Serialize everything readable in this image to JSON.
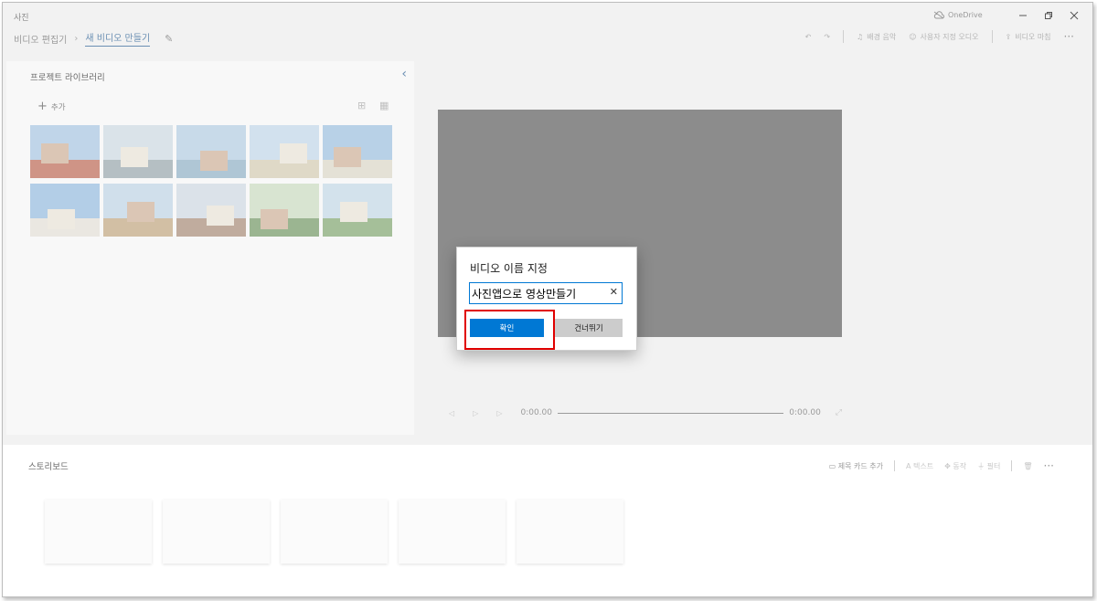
{
  "app": {
    "title": "사진",
    "onedrive_label": "OneDrive"
  },
  "breadcrumb": {
    "items": [
      "비디오 편집기",
      "새 비디오 만들기"
    ]
  },
  "toolbar": {
    "background_music": "배경 음악",
    "custom_audio": "사용자 지정 오디오",
    "finish_video": "비디오 마침"
  },
  "library": {
    "title": "프로젝트 라이브러리",
    "add_label": "추가",
    "thumbnails": [
      {
        "icon": "temple-roof-photo",
        "sky": "#9bbfe0",
        "ground": "#b5533c"
      },
      {
        "icon": "pier-photo",
        "sky": "#c7d6e0",
        "ground": "#8a9aa0"
      },
      {
        "icon": "sea-horizon-photo",
        "sky": "#a9c7e0",
        "ground": "#7fa5bf"
      },
      {
        "icon": "colonial-building-photo",
        "sky": "#b9d3e8",
        "ground": "#cfc6a8"
      },
      {
        "icon": "white-mansion-photo",
        "sky": "#8fb8dd",
        "ground": "#d8d2c0"
      },
      {
        "icon": "white-palace-photo",
        "sky": "#86b3dc",
        "ground": "#e1ddd3"
      },
      {
        "icon": "chinese-gate-photo",
        "sky": "#b6cfe3",
        "ground": "#b99a6d"
      },
      {
        "icon": "shophouse-photo",
        "sky": "#c8d5e0",
        "ground": "#9c7a64"
      },
      {
        "icon": "hillside-houses-photo",
        "sky": "#c4d8b8",
        "ground": "#5f8a4d"
      },
      {
        "icon": "temple-among-trees-photo",
        "sky": "#bcd4e5",
        "ground": "#6f9a5b"
      }
    ]
  },
  "player": {
    "current_time": "0:00.00",
    "total_time": "0:00.00"
  },
  "storyboard": {
    "title": "스토리보드",
    "title_card": "제목 카드 추가",
    "text": "텍스트",
    "motion": "동작",
    "filters": "필터"
  },
  "dialog": {
    "title": "비디오 이름 지정",
    "input_value": "사진앱으로 영상만들기",
    "ok_label": "확인",
    "skip_label": "건너뛰기"
  },
  "colors": {
    "accent": "#0078d4",
    "highlight": "#e00000",
    "preview_bg": "#8c8c8c"
  }
}
